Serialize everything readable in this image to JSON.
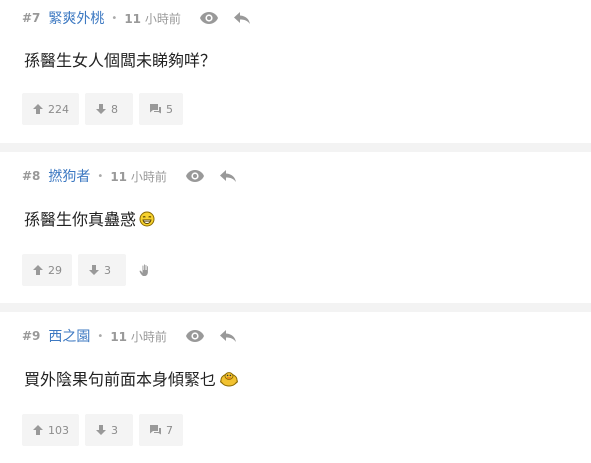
{
  "posts": [
    {
      "number": "#7",
      "author": "緊爽外桃",
      "time_value": "11",
      "time_unit": "小時前",
      "content": "孫醫生女人個闆未睇夠咩？",
      "upvotes": "224",
      "downvotes": "8",
      "quotes": "5"
    },
    {
      "number": "#8",
      "author": "撚狗者",
      "time_value": "11",
      "time_unit": "小時前",
      "content": "孫醫生你真蠱惑",
      "emoji": "grin-emoji",
      "upvotes": "29",
      "downvotes": "3",
      "quotes": ""
    },
    {
      "number": "#9",
      "author": "西之園",
      "time_value": "11",
      "time_unit": "小時前",
      "content": "買外陰果句前面本身傾緊乜",
      "emoji": "duck-emoji",
      "upvotes": "103",
      "downvotes": "3",
      "quotes": "7"
    }
  ],
  "colors": {
    "author": "#3d79c2",
    "meta": "#999999",
    "background": "#f3f3f3",
    "button": "#f4f4f4"
  },
  "icons": {
    "view": "eye-icon",
    "reply": "reply-icon",
    "upvote": "thumb-up-icon",
    "downvote": "thumb-down-icon",
    "quote": "comment-icon",
    "report": "hand-icon"
  }
}
